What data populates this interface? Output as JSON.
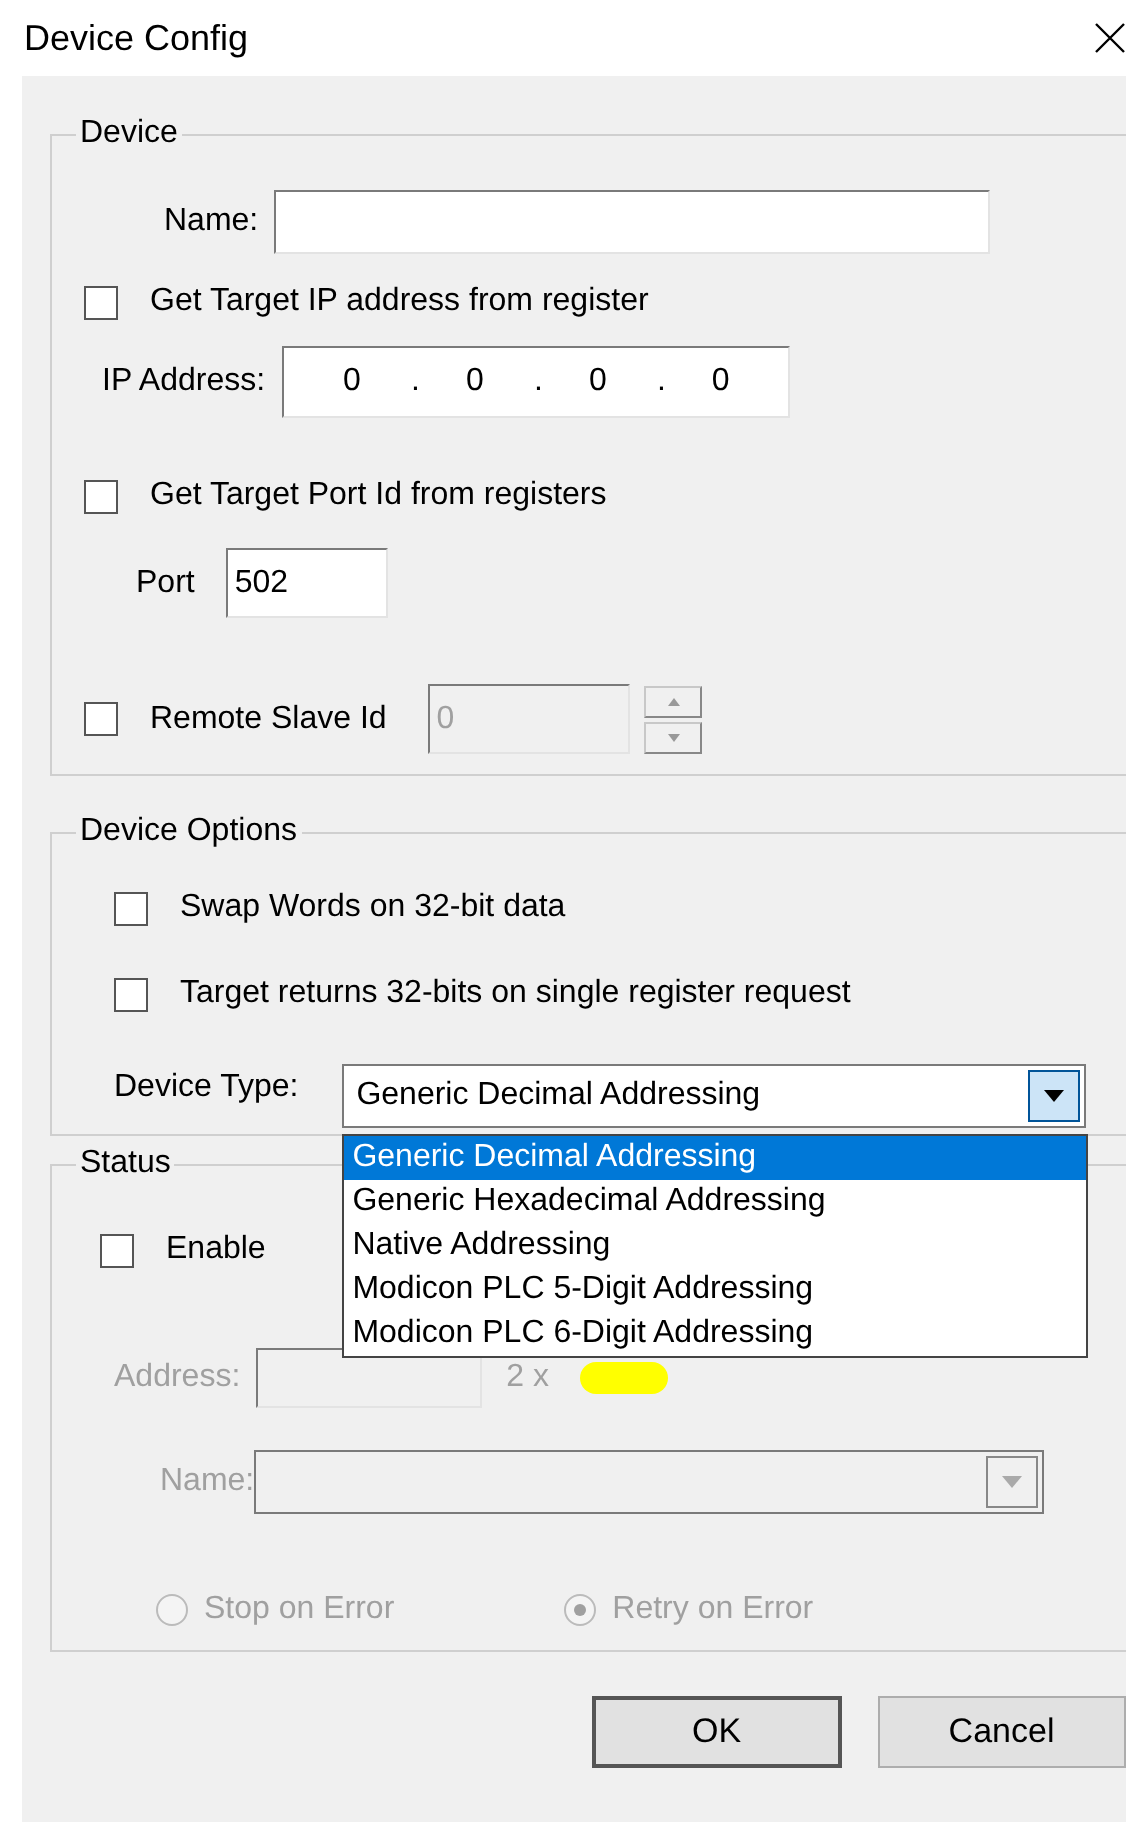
{
  "window": {
    "title": "Device Config"
  },
  "device": {
    "legend": "Device",
    "name": {
      "label": "Name:"
    },
    "ip_from_register": {
      "label": "Get Target IP address from register",
      "checked": false
    },
    "ip_address": {
      "label": "IP Address:",
      "octets": [
        "0",
        "0",
        "0",
        "0"
      ],
      "dots": [
        ".",
        ".",
        "."
      ]
    },
    "port_from_registers": {
      "label": "Get Target Port Id from registers",
      "checked": false
    },
    "port": {
      "label": "Port",
      "value": "502"
    },
    "remote_slave_id": {
      "label": "Remote Slave Id",
      "checked": false,
      "value": "0",
      "disabled": true
    }
  },
  "device_options": {
    "legend": "Device Options",
    "checkboxes": [
      {
        "label": "Swap Words on 32-bit data",
        "checked": false
      },
      {
        "label": "Target returns 32-bits on single register request",
        "checked": false
      }
    ],
    "device_type": {
      "label": "Device Type:",
      "value": "Generic Decimal Addressing",
      "expanded": true,
      "options": [
        {
          "label": "Generic Decimal Addressing",
          "selected": true
        },
        {
          "label": "Generic Hexadecimal Addressing",
          "selected": false
        },
        {
          "label": "Native Addressing",
          "selected": false
        },
        {
          "label": "Modicon PLC 5-Digit Addressing",
          "selected": false
        },
        {
          "label": "Modicon PLC 6-Digit Addressing",
          "selected": false
        }
      ]
    }
  },
  "status": {
    "legend": "Status",
    "enable": {
      "label": "Enable",
      "checked": false
    },
    "address": {
      "label": "Address:",
      "multiplier": "2 x",
      "disabled": true
    },
    "name": {
      "label": "Name:",
      "disabled": true
    },
    "radios": [
      {
        "label": "Stop on Error",
        "selected": false,
        "disabled": true
      },
      {
        "label": "Retry on Error",
        "selected": true,
        "disabled": true
      }
    ]
  },
  "buttons": [
    {
      "label": "OK",
      "default": true
    },
    {
      "label": "Cancel",
      "default": false
    }
  ]
}
